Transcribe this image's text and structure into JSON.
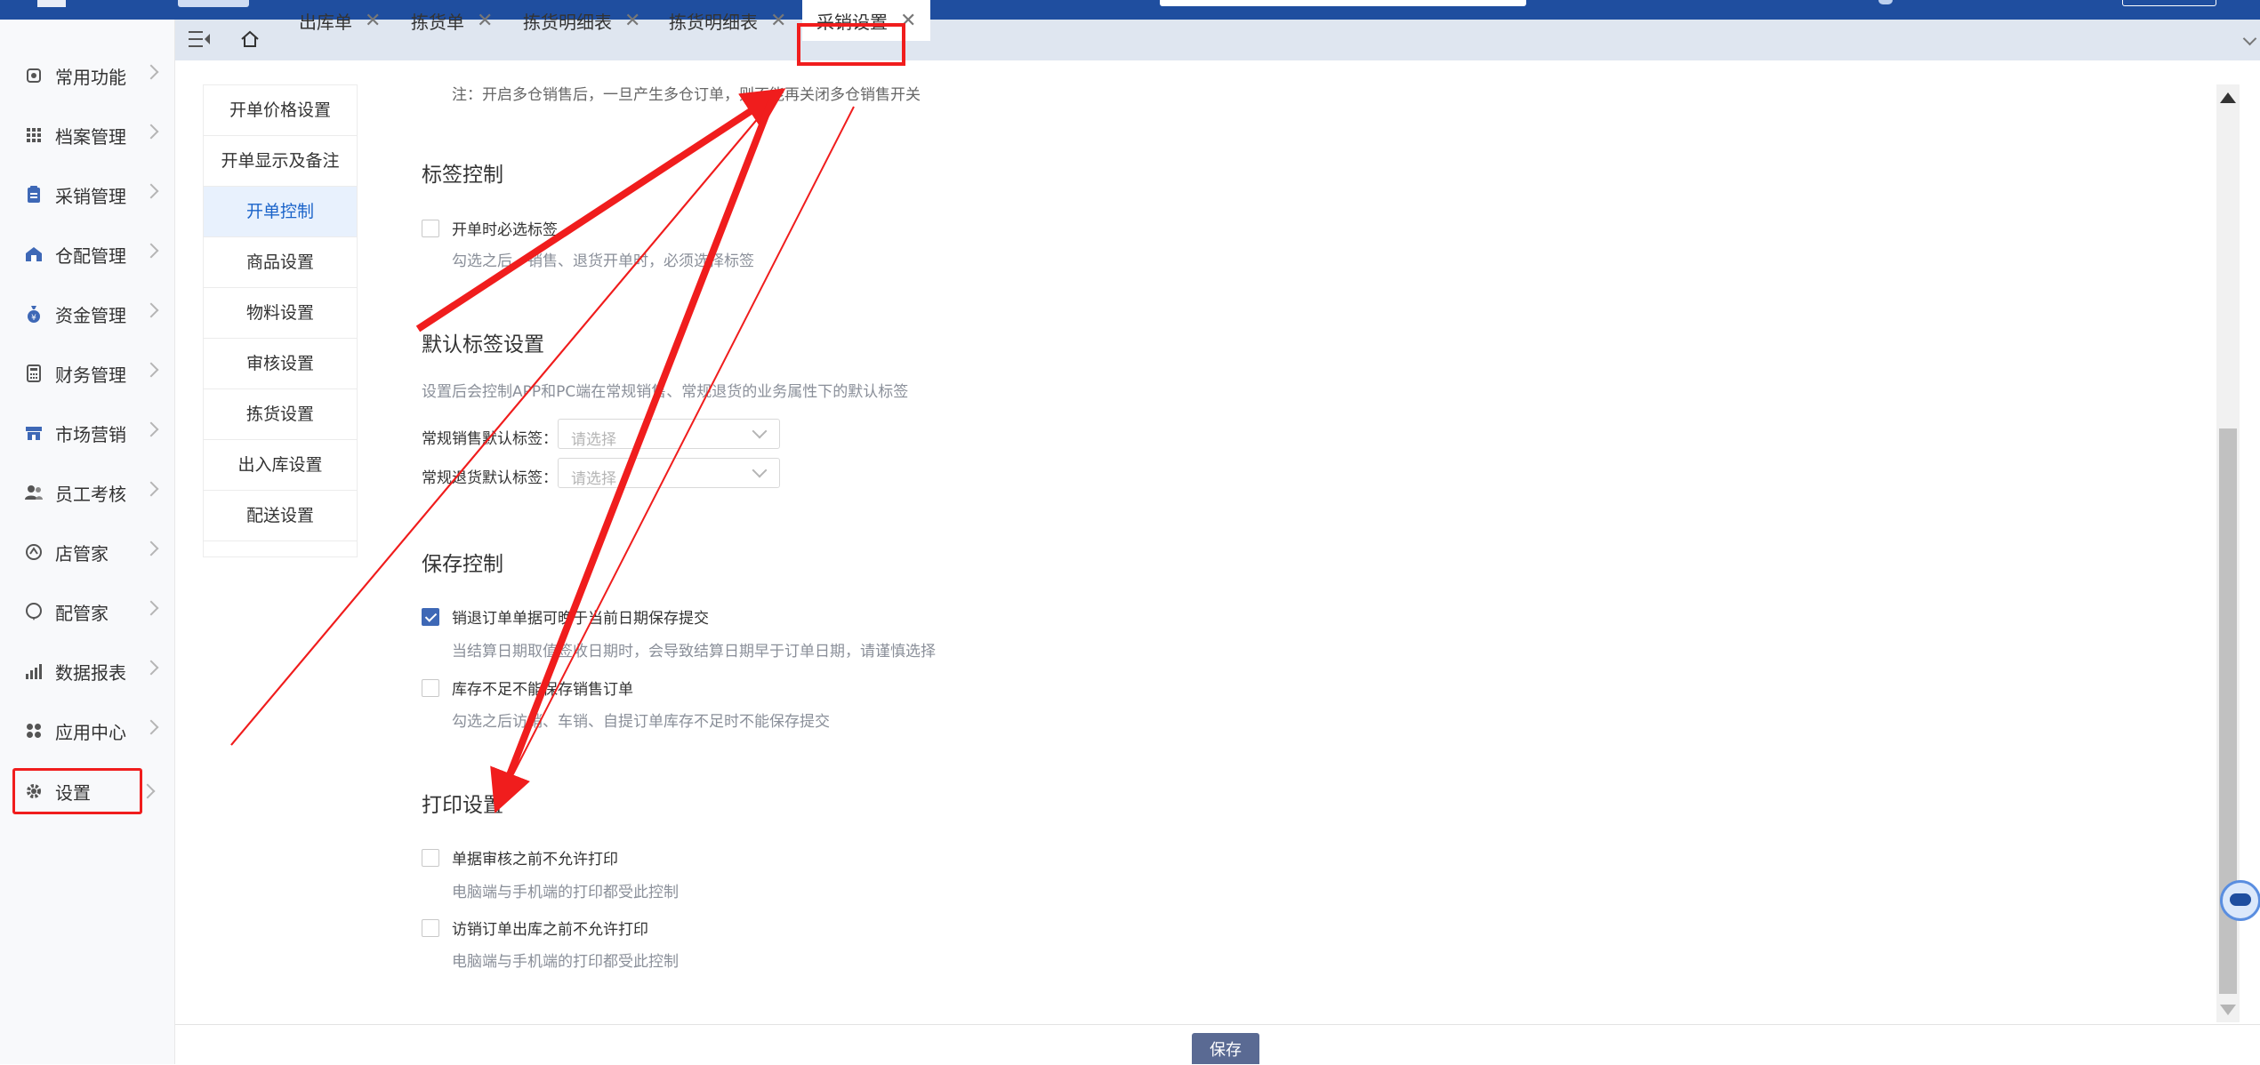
{
  "sidebar": {
    "items": [
      {
        "label": "常用功能",
        "icon": "home-icon"
      },
      {
        "label": "档案管理",
        "icon": "grid-icon"
      },
      {
        "label": "采销管理",
        "icon": "clipboard-icon"
      },
      {
        "label": "仓配管理",
        "icon": "warehouse-icon"
      },
      {
        "label": "资金管理",
        "icon": "money-bag-icon"
      },
      {
        "label": "财务管理",
        "icon": "calculator-icon"
      },
      {
        "label": "市场营销",
        "icon": "store-icon"
      },
      {
        "label": "员工考核",
        "icon": "users-icon"
      },
      {
        "label": "店管家",
        "icon": "shop-icon"
      },
      {
        "label": "配管家",
        "icon": "chat-icon"
      },
      {
        "label": "数据报表",
        "icon": "bar-chart-icon"
      },
      {
        "label": "应用中心",
        "icon": "apps-icon"
      },
      {
        "label": "设置",
        "icon": "gear-icon"
      }
    ]
  },
  "tabs": [
    {
      "label": "出库单"
    },
    {
      "label": "拣货单"
    },
    {
      "label": "拣货明细表"
    },
    {
      "label": "拣货明细表"
    },
    {
      "label": "采销设置"
    }
  ],
  "subnav": {
    "items": [
      {
        "label": "开单价格设置"
      },
      {
        "label": "开单显示及备注"
      },
      {
        "label": "开单控制"
      },
      {
        "label": "商品设置"
      },
      {
        "label": "物料设置"
      },
      {
        "label": "审核设置"
      },
      {
        "label": "拣货设置"
      },
      {
        "label": "出入库设置"
      },
      {
        "label": "配送设置"
      }
    ]
  },
  "content": {
    "note": "注：开启多仓销售后，一旦产生多仓订单，则不能再关闭多仓销售开关",
    "tag_control": {
      "title": "标签控制",
      "option_label": "开单时必选标签",
      "option_desc": "勾选之后，销售、退货开单时，必须选择标签"
    },
    "default_tag": {
      "title": "默认标签设置",
      "desc": "设置后会控制APP和PC端在常规销售、常规退货的业务属性下的默认标签",
      "sale_label": "常规销售默认标签：",
      "return_label": "常规退货默认标签：",
      "placeholder": "请选择"
    },
    "save_control": {
      "title": "保存控制",
      "opt1_label": "销退订单单据可晚于当前日期保存提交",
      "opt1_desc": "当结算日期取值签收日期时，会导致结算日期早于订单日期，请谨慎选择",
      "opt2_label": "库存不足不能保存销售订单",
      "opt2_desc": "勾选之后访销、车销、自提订单库存不足时不能保存提交"
    },
    "print_settings": {
      "title": "打印设置",
      "opt1_label": "单据审核之前不允许打印",
      "opt1_desc": "电脑端与手机端的打印都受此控制",
      "opt2_label": "访销订单出库之前不允许打印",
      "opt2_desc": "电脑端与手机端的打印都受此控制"
    }
  },
  "footer": {
    "save_label": "保存"
  },
  "colors": {
    "primary": "#1f4e9f",
    "highlight": "#f01d1d",
    "accent": "#3e68b6"
  }
}
